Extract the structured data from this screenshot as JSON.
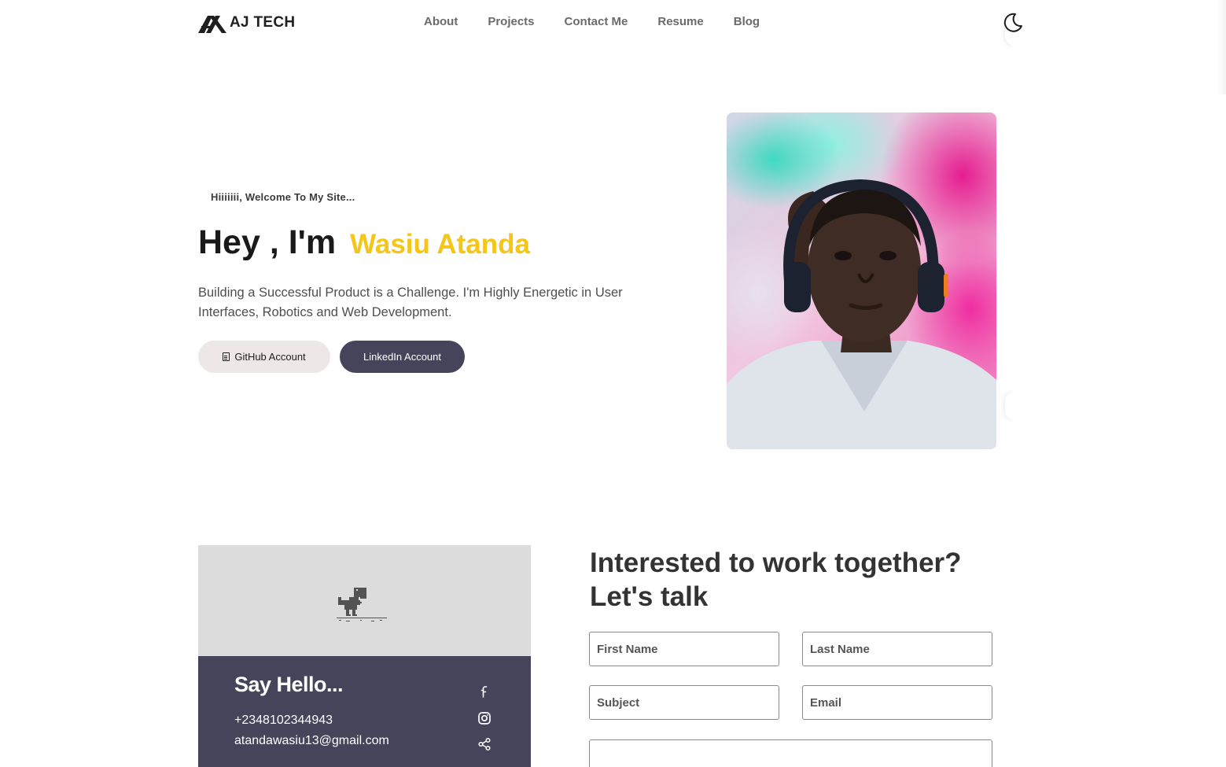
{
  "brand": {
    "name": "AJ TECH",
    "icon": "aj-logo-icon"
  },
  "nav": {
    "links": [
      "About",
      "Projects",
      "Contact Me",
      "Resume",
      "Blog"
    ],
    "theme_toggle_icon": "moon-icon"
  },
  "hero": {
    "welcome": "Hiiiiiii, Welcome To My Site...",
    "greeting": "Hey , I'm",
    "name": "Wasiu Atanda",
    "description": "Building a Successful Product is a Challenge. I'm Highly Energetic in User Interfaces, Robotics and Web Development.",
    "github_button": "GitHub Account",
    "linkedin_button": "LinkedIn Account",
    "accent_color": "#f5c518"
  },
  "contact": {
    "card_image_icon": "dino-icon",
    "title": "Say Hello...",
    "phone": "+2348102344943",
    "email": "atandawasiu13@gmail.com",
    "social_icons": [
      "facebook-icon",
      "instagram-icon",
      "share-icon"
    ],
    "card_color": "#45445a"
  },
  "form": {
    "title": "Interested to work together? Let's talk",
    "first_name_placeholder": "First Name",
    "last_name_placeholder": "Last Name",
    "subject_placeholder": "Subject",
    "email_placeholder": "Email",
    "message_placeholder": ""
  }
}
